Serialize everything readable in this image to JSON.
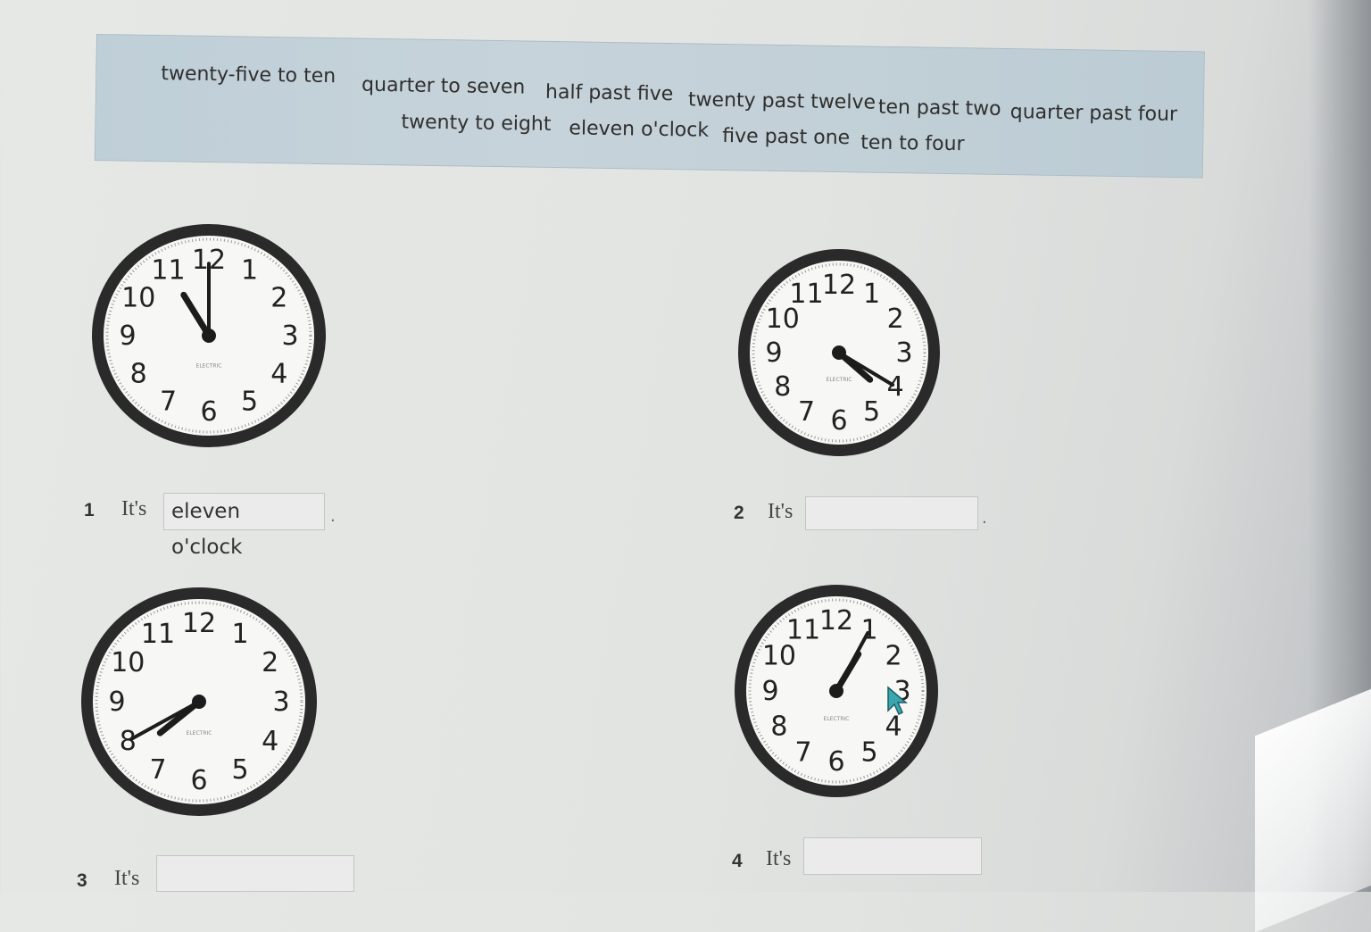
{
  "word_bank": [
    "twenty-five to ten",
    "quarter to seven",
    "half past five",
    "twenty past twelve",
    "ten past two",
    "quarter past four",
    "twenty to eight",
    "eleven o'clock",
    "five past one",
    "ten to four"
  ],
  "clock_numerals": [
    "12",
    "1",
    "2",
    "3",
    "4",
    "5",
    "6",
    "7",
    "8",
    "9",
    "10",
    "11"
  ],
  "clock_brand": "ELECTRIC",
  "questions": [
    {
      "number": "1",
      "prefix": "It's",
      "answer": "eleven o'clock",
      "time": "11:00"
    },
    {
      "number": "2",
      "prefix": "It's",
      "answer": "",
      "time": "4:20"
    },
    {
      "number": "3",
      "prefix": "It's",
      "answer": "",
      "time": "7:40"
    },
    {
      "number": "4",
      "prefix": "It's",
      "answer": "",
      "time": "1:05"
    }
  ],
  "colors": {
    "word_bank_bg": "#c2d1d9",
    "accent_cursor": "#3aa6b0"
  }
}
